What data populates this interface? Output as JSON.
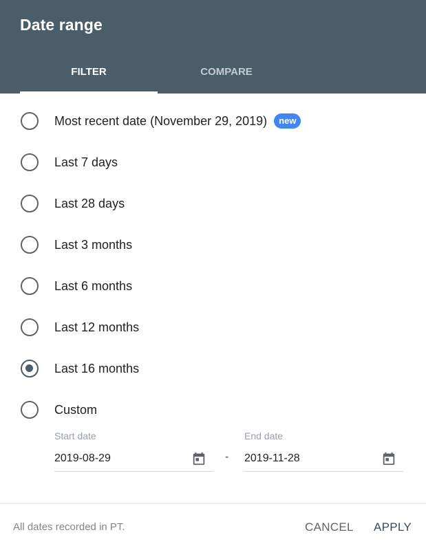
{
  "dialog": {
    "title": "Date range",
    "tabs": [
      {
        "label": "FILTER",
        "active": true
      },
      {
        "label": "COMPARE",
        "active": false
      }
    ]
  },
  "options": [
    {
      "label": "Most recent date (November 29, 2019)",
      "badge": "new",
      "selected": false
    },
    {
      "label": "Last 7 days",
      "selected": false
    },
    {
      "label": "Last 28 days",
      "selected": false
    },
    {
      "label": "Last 3 months",
      "selected": false
    },
    {
      "label": "Last 6 months",
      "selected": false
    },
    {
      "label": "Last 12 months",
      "selected": false
    },
    {
      "label": "Last 16 months",
      "selected": true
    },
    {
      "label": "Custom",
      "selected": false
    }
  ],
  "custom": {
    "start": {
      "label": "Start date",
      "value": "2019-08-29",
      "icon": "calendar-icon"
    },
    "separator": "-",
    "end": {
      "label": "End date",
      "value": "2019-11-28",
      "icon": "calendar-icon"
    }
  },
  "footer": {
    "note": "All dates recorded in PT.",
    "cancel_label": "CANCEL",
    "apply_label": "APPLY"
  },
  "colors": {
    "header_bg": "#4a5d69",
    "badge_bg": "#4285f4",
    "selected_radio": "#4a5d69"
  }
}
